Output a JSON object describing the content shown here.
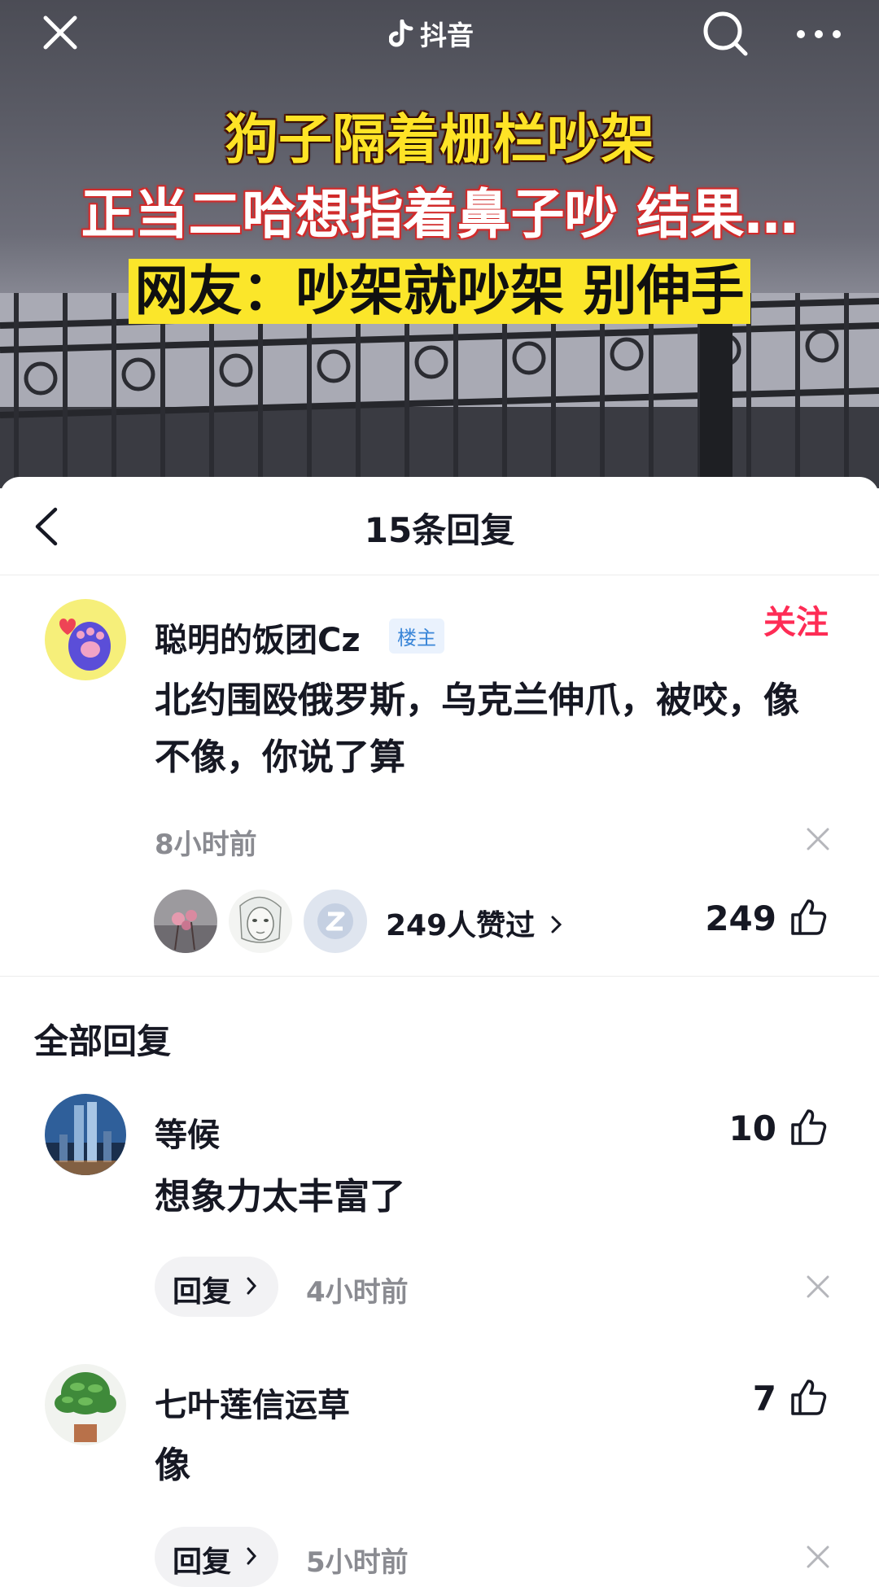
{
  "topbar": {
    "app_name": "抖音"
  },
  "video": {
    "caption_line1": "狗子隔着栅栏吵架",
    "caption_line2": "正当二哈想指着鼻子吵 结果…",
    "caption_line3": "网友：吵架就吵架 别伸手"
  },
  "sheet": {
    "title": "15条回复"
  },
  "main_comment": {
    "author": "聪明的饭团Cz",
    "badge": "楼主",
    "follow_label": "关注",
    "text": "北约围殴俄罗斯，乌克兰伸爪，被咬，像不像，你说了算",
    "time": "8小时前",
    "likers_text": "249人赞过",
    "like_count": "249"
  },
  "section_title": "全部回复",
  "replies": [
    {
      "author": "等候",
      "text": "想象力太丰富了",
      "reply_label": "回复",
      "time": "4小时前",
      "like_count": "10"
    },
    {
      "author": "七叶莲信运草",
      "text": "像",
      "reply_label": "回复",
      "time": "5小时前",
      "like_count": "7"
    }
  ],
  "colors": {
    "accent": "#fe2c55",
    "badge_blue": "#3a86d8",
    "caption_yellow": "#fbe62a",
    "muted": "#8a8b91"
  }
}
